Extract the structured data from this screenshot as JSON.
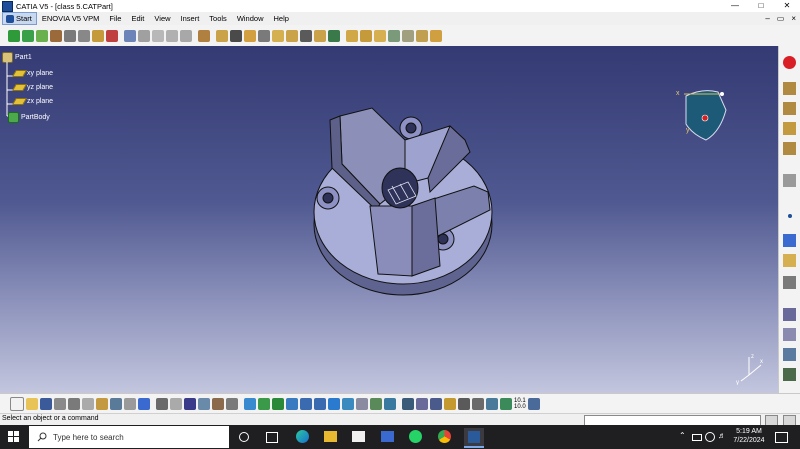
{
  "window": {
    "title": "CATIA V5 - [class 5.CATPart]"
  },
  "menu": {
    "start": "Start",
    "items": [
      "ENOVIA V5 VPM",
      "File",
      "Edit",
      "View",
      "Insert",
      "Tools",
      "Window",
      "Help"
    ]
  },
  "tree": {
    "root": "Part1",
    "nodes": [
      "xy plane",
      "yz plane",
      "zx plane",
      "PartBody"
    ]
  },
  "compass": {
    "x_label": "x",
    "y_label": "y"
  },
  "axis_triad": {
    "x": "x",
    "y": "y",
    "z": "z"
  },
  "status": {
    "prompt": "Select an object or a command"
  },
  "toolbar_bottom": {
    "ratio_label": "10.1\n10.0"
  },
  "taskbar": {
    "search_placeholder": "Type here to search",
    "time": "5:19 AM",
    "date": "7/22/2024"
  },
  "colors": {
    "viewport_top": "#343a73",
    "viewport_bottom": "#c3c6de",
    "part_fill": "#a9aed9"
  }
}
